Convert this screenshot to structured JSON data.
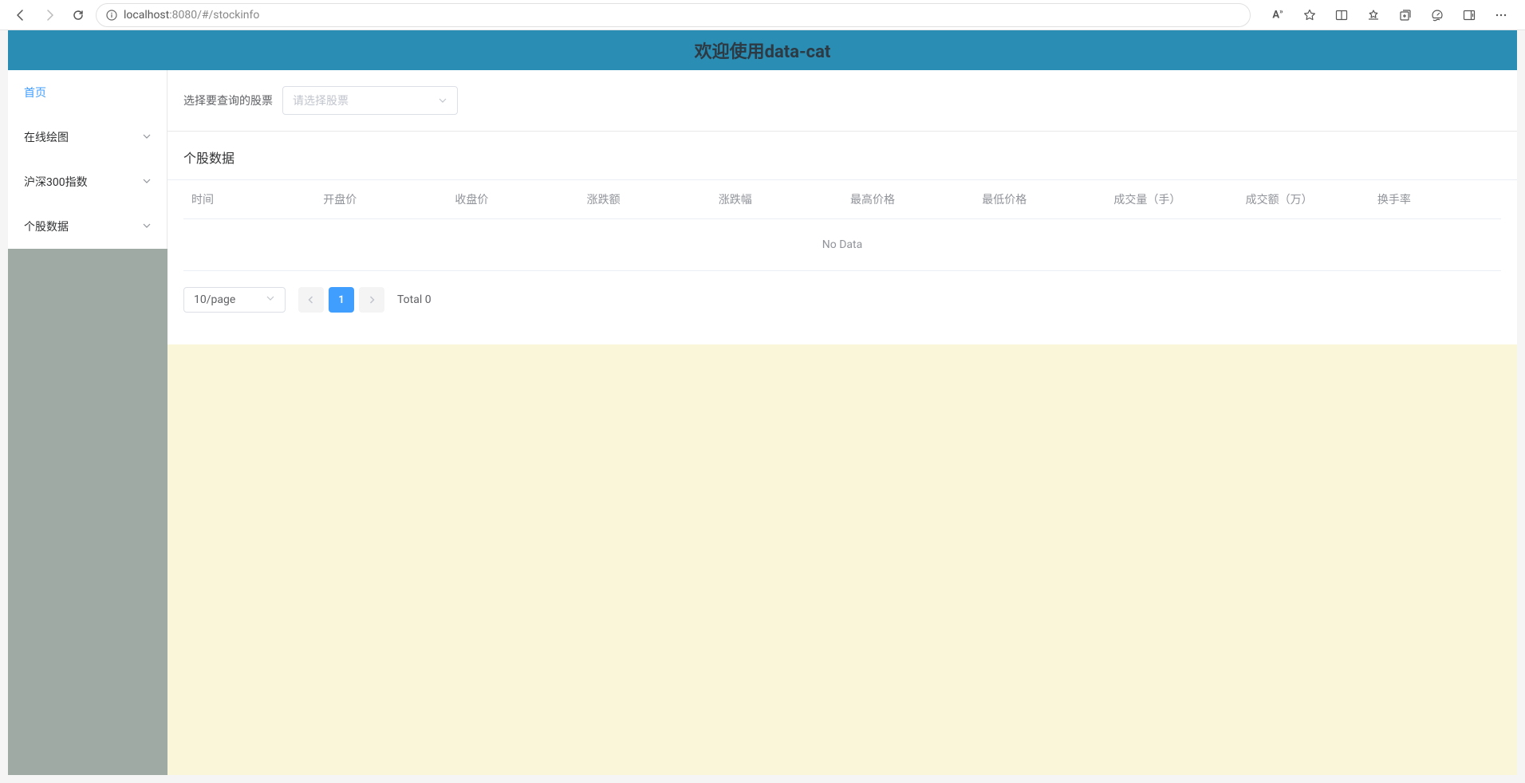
{
  "browser": {
    "url_host": "localhost",
    "url_port": ":8080",
    "url_path": "/#/stockinfo"
  },
  "header": {
    "title": "欢迎使用data-cat"
  },
  "sidebar": {
    "items": [
      {
        "label": "首页",
        "expandable": false,
        "active": true
      },
      {
        "label": "在线绘图",
        "expandable": true,
        "active": false
      },
      {
        "label": "沪深300指数",
        "expandable": true,
        "active": false
      },
      {
        "label": "个股数据",
        "expandable": true,
        "active": false
      }
    ]
  },
  "filter": {
    "label": "选择要查询的股票",
    "placeholder": "请选择股票"
  },
  "panel": {
    "title": "个股数据",
    "columns": [
      "时间",
      "开盘价",
      "收盘价",
      "涨跌额",
      "涨跌幅",
      "最高价格",
      "最低价格",
      "成交量（手）",
      "成交额（万）",
      "换手率"
    ],
    "empty_text": "No Data"
  },
  "pagination": {
    "page_size_label": "10/page",
    "current_page": "1",
    "total_label": "Total 0"
  }
}
